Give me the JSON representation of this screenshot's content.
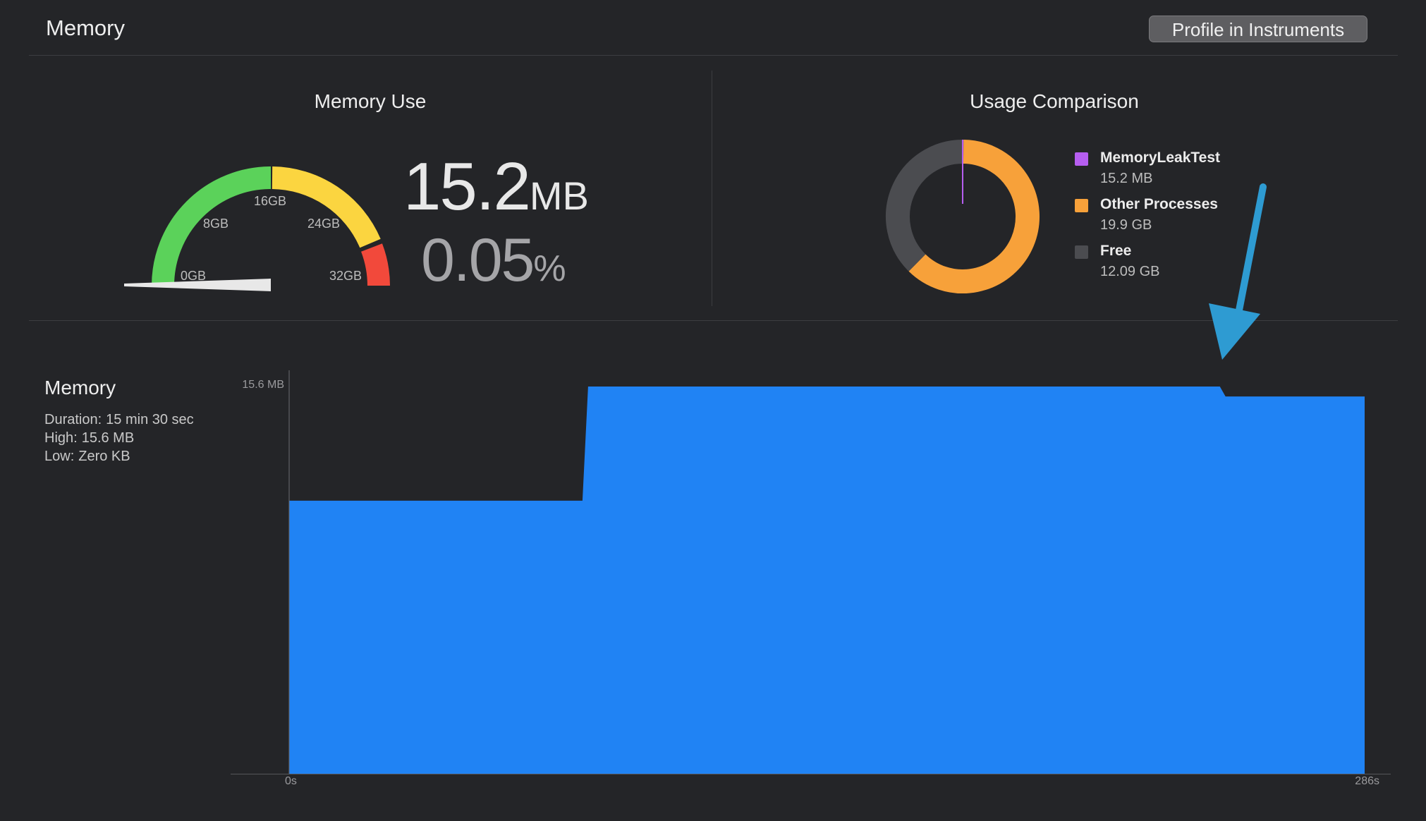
{
  "header": {
    "title": "Memory",
    "profile_button": "Profile in Instruments"
  },
  "memory_use": {
    "title": "Memory Use",
    "value": "15.2",
    "value_unit": "MB",
    "percent": "0.05",
    "percent_unit": "%",
    "gauge_labels": [
      "0GB",
      "8GB",
      "16GB",
      "24GB",
      "32GB"
    ],
    "gauge_level_fraction": 0.0,
    "gauge_colors": {
      "green": "#5bd25a",
      "yellow": "#fbd540",
      "red": "#f2493b"
    }
  },
  "usage_comparison": {
    "title": "Usage Comparison",
    "legend": [
      {
        "name": "MemoryLeakTest",
        "value": "15.2 MB",
        "color": "#b65ef0"
      },
      {
        "name": "Other Processes",
        "value": "19.9 GB",
        "color": "#f7a13a"
      },
      {
        "name": "Free",
        "value": "12.09 GB",
        "color": "#4b4c50"
      }
    ]
  },
  "memory_graph": {
    "title": "Memory",
    "stats": [
      {
        "label": "Duration:",
        "value": "15 min 30 sec"
      },
      {
        "label": "High:",
        "value": "15.6 MB"
      },
      {
        "label": "Low:",
        "value": "Zero KB"
      }
    ]
  },
  "chart_data": {
    "type": "area",
    "title": "",
    "xlabel": "",
    "ylabel": "",
    "x_tick_labels": [
      "0s",
      "286s"
    ],
    "y_tick_labels": [
      "15.6 MB"
    ],
    "xlim": [
      0,
      286
    ],
    "ylim": [
      0,
      15.6
    ],
    "color": "#2083f4",
    "x": [
      0,
      78,
      79.5,
      247.5,
      249,
      286
    ],
    "values": [
      11.0,
      11.0,
      15.6,
      15.6,
      15.2,
      15.2
    ]
  },
  "annotation": {
    "arrow_color": "#2e9bd2",
    "arrow_icon": "arrow-down-left-icon"
  }
}
